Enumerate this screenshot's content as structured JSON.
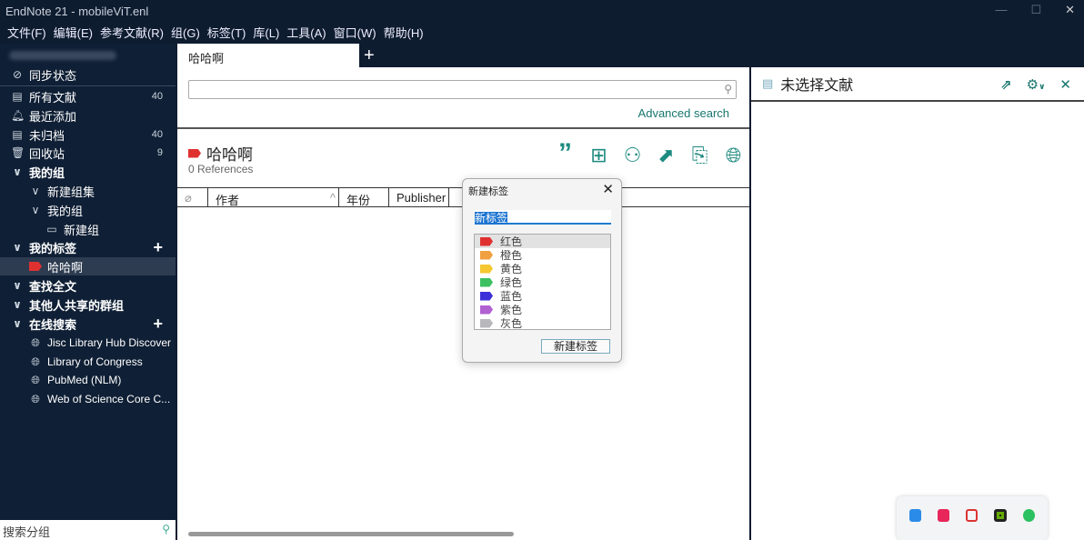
{
  "window": {
    "title": "EndNote 21 - mobileViT.enl",
    "minimize": "—",
    "maximize": "☐",
    "close": "✕"
  },
  "menu": [
    "文件(F)",
    "编辑(E)",
    "参考文献(R)",
    "组(G)",
    "标签(T)",
    "库(L)",
    "工具(A)",
    "窗口(W)",
    "帮助(H)"
  ],
  "sidebar": {
    "sync": "同步状态",
    "items": [
      {
        "label": "所有文献",
        "count": "40"
      },
      {
        "label": "最近添加",
        "count": ""
      },
      {
        "label": "未归档",
        "count": "40"
      },
      {
        "label": "回收站",
        "count": "9"
      }
    ],
    "my_groups": "我的组",
    "group_set": "新建组集",
    "my_group": "我的组",
    "new_group": "新建组",
    "my_tags": "我的标签",
    "tag": "哈哈啊",
    "find_full_text": "查找全文",
    "shared_groups": "其他人共享的群组",
    "online_search": "在线搜索",
    "online": [
      "Jisc Library Hub Discover",
      "Library of Congress",
      "PubMed (NLM)",
      "Web of Science Core C..."
    ],
    "search_placeholder": "搜索分组"
  },
  "main": {
    "tab": "哈哈啊",
    "advanced_search": "Advanced search",
    "group_title": "哈哈啊",
    "references": "0 References",
    "columns": [
      "作者",
      "年份",
      "Publisher"
    ]
  },
  "right_panel": {
    "title": "未选择文献"
  },
  "dialog": {
    "title": "新建标签",
    "input_value": "新标签",
    "button": "新建标签",
    "colors": [
      {
        "label": "红色",
        "color": "#e03131"
      },
      {
        "label": "橙色",
        "color": "#f0a040"
      },
      {
        "label": "黄色",
        "color": "#f5c730"
      },
      {
        "label": "绿色",
        "color": "#3cc060"
      },
      {
        "label": "蓝色",
        "color": "#3b2fd8"
      },
      {
        "label": "紫色",
        "color": "#b060d0"
      },
      {
        "label": "灰色",
        "color": "#b8b8bc"
      }
    ]
  },
  "colors": {
    "accent": "#17766e",
    "tag": "#e03131"
  }
}
